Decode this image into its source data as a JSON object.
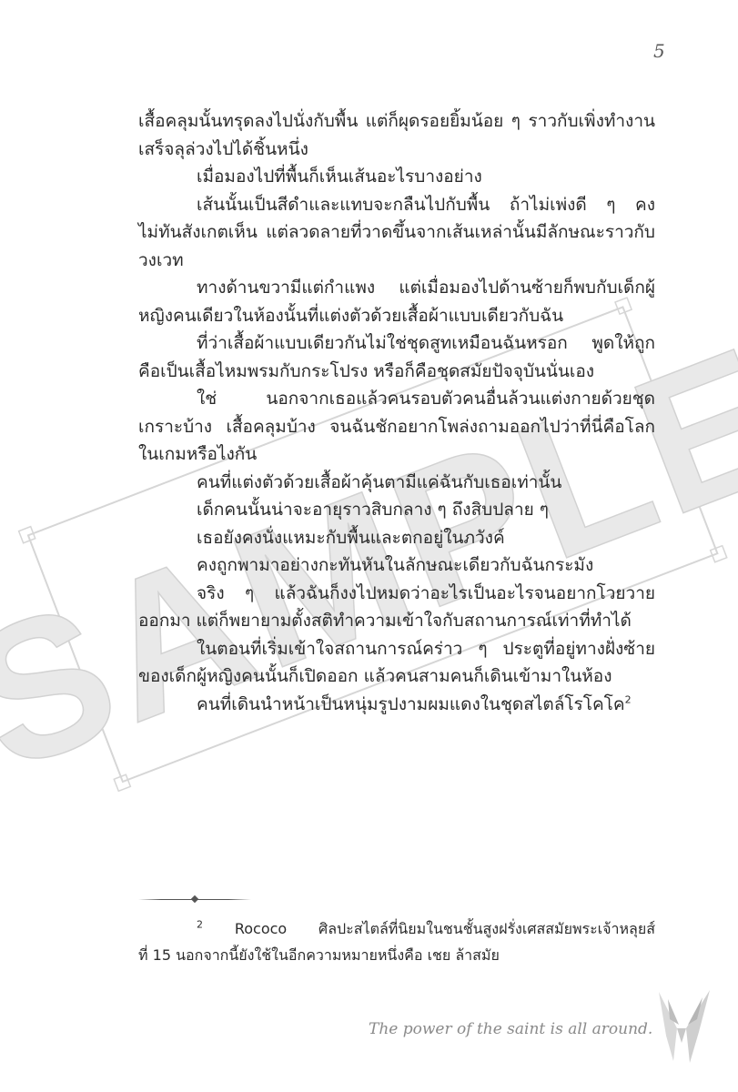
{
  "page": {
    "number": "5"
  },
  "body": {
    "paragraphs": [
      "เสื้อคลุมนั้นทรุดลงไปนั่งกับพื้น แต่ก็ผุดรอยยิ้มน้อย ๆ ราวกับเพิ่งทำงานเสร็จลุล่วงไปได้ชิ้นหนึ่ง",
      "เมื่อมองไปที่พื้นก็เห็นเส้นอะไรบางอย่าง",
      "เส้นนั้นเป็นสีดำและแทบจะกลืนไปกับพื้น ถ้าไม่เพ่งดี ๆ คงไม่ทันสังเกตเห็น แต่ลวดลายที่วาดขึ้นจากเส้นเหล่านั้นมีลักษณะราวกับวงเวท",
      "ทางด้านขวามีแต่กำแพง แต่เมื่อมองไปด้านซ้ายก็พบกับเด็กผู้หญิงคนเดียวในห้องนั้นที่แต่งตัวด้วยเสื้อผ้าแบบเดียวกับฉัน",
      "ที่ว่าเสื้อผ้าแบบเดียวกันไม่ใช่ชุดสูทเหมือนฉันหรอก พูดให้ถูกคือเป็นเสื้อไหมพรมกับกระโปรง หรือก็คือชุดสมัยปัจจุบันนั่นเอง",
      "ใช่ นอกจากเธอแล้วคนรอบตัวคนอื่นล้วนแต่งกายด้วยชุดเกราะบ้าง เสื้อคลุมบ้าง จนฉันชักอยากโพล่งถามออกไปว่าที่นี่คือโลกในเกมหรือไงกัน",
      "คนที่แต่งตัวด้วยเสื้อผ้าคุ้นตามีแค่ฉันกับเธอเท่านั้น",
      "เด็กคนนั้นน่าจะอายุราวสิบกลาง ๆ ถึงสิบปลาย ๆ",
      "เธอยังคงนั่งแหมะกับพื้นและตกอยู่ในภวังค์",
      "คงถูกพามาอย่างกะทันหันในลักษณะเดียวกับฉันกระมัง",
      "จริง ๆ แล้วฉันก็งงไปหมดว่าอะไรเป็นอะไรจนอยากโวยวายออกมา แต่ก็พยายามตั้งสติทำความเข้าใจกับสถานการณ์เท่าที่ทำได้",
      "ในตอนที่เริ่มเข้าใจสถานการณ์คร่าว ๆ ประตูที่อยู่ทางฝั่งซ้ายของเด็กผู้หญิงคนนั้นก็เปิดออก แล้วคนสามคนก็เดินเข้ามาในห้อง",
      "คนที่เดินนำหน้าเป็นหนุ่มรูปงามผมแดงในชุดสไตล์โรโคโค"
    ],
    "footnote_marker": "2"
  },
  "footnote": {
    "marker": "2",
    "line1": "Rococo ศิลปะสไตล์ที่นิยมในชนชั้นสูงฝรั่งเศสสมัยพระเจ้าหลุยส์",
    "line2": "ที่ 15 นอกจากนี้ยังใช้ในอีกความหมายหนึ่งคือ เชย ล้าสมัย"
  },
  "watermark": {
    "text": "SAMPLE"
  },
  "footer": {
    "slogan": "The power of the saint is all around."
  }
}
